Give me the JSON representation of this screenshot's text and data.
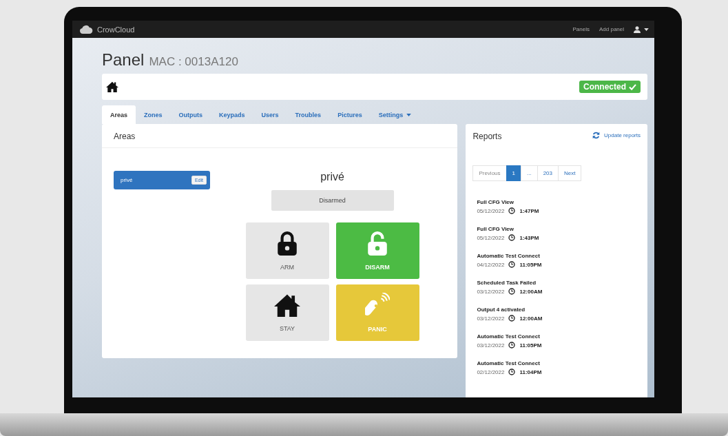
{
  "topbar": {
    "brand": "CrowCloud",
    "links": [
      "Panels",
      "Add panel"
    ]
  },
  "header": {
    "title": "Panel",
    "subtitle": "MAC : 0013A120"
  },
  "status": {
    "label": "Connected",
    "connected": true
  },
  "tabs": [
    {
      "label": "Areas",
      "selected": true,
      "has_menu": false
    },
    {
      "label": "Zones",
      "selected": false,
      "has_menu": false
    },
    {
      "label": "Outputs",
      "selected": false,
      "has_menu": false
    },
    {
      "label": "Keypads",
      "selected": false,
      "has_menu": false
    },
    {
      "label": "Users",
      "selected": false,
      "has_menu": false
    },
    {
      "label": "Troubles",
      "selected": false,
      "has_menu": false
    },
    {
      "label": "Pictures",
      "selected": false,
      "has_menu": false
    },
    {
      "label": "Settings",
      "selected": false,
      "has_menu": true
    }
  ],
  "areas_panel": {
    "title": "Areas",
    "areas": [
      {
        "name": "privé",
        "selected": true,
        "edit_label": "Edit"
      }
    ],
    "area_name": "privé",
    "state": "Disarmed",
    "actions": [
      {
        "label": "ARM",
        "kind": "arm",
        "color": "#e6e6e6"
      },
      {
        "label": "DISARM",
        "kind": "disarm",
        "color": "#4cbb44"
      },
      {
        "label": "STAY",
        "kind": "stay",
        "color": "#e6e6e6"
      },
      {
        "label": "PANIC",
        "kind": "panic",
        "color": "#e6c83a"
      }
    ]
  },
  "reports": {
    "title": "Reports",
    "update_label": "Update reports",
    "pagination": [
      {
        "label": "Previous",
        "selected": false
      },
      {
        "label": "1",
        "selected": true
      },
      {
        "label": "...",
        "selected": false
      },
      {
        "label": "203",
        "selected": false
      },
      {
        "label": "Next",
        "selected": false
      }
    ],
    "entries": [
      {
        "title": "Full CFG View",
        "date": "05/12/2022",
        "time": "1:47PM"
      },
      {
        "title": "Full CFG View",
        "date": "05/12/2022",
        "time": "1:43PM"
      },
      {
        "title": "Automatic Test Connect",
        "date": "04/12/2022",
        "time": "11:05PM"
      },
      {
        "title": "Scheduled Task Failed",
        "date": "03/12/2022",
        "time": "12:00AM"
      },
      {
        "title": "Output 4 activated",
        "date": "03/12/2022",
        "time": "12:00AM"
      },
      {
        "title": "Automatic Test Connect",
        "date": "03/12/2022",
        "time": "11:05PM"
      },
      {
        "title": "Automatic Test Connect",
        "date": "02/12/2022",
        "time": "11:04PM"
      }
    ]
  }
}
